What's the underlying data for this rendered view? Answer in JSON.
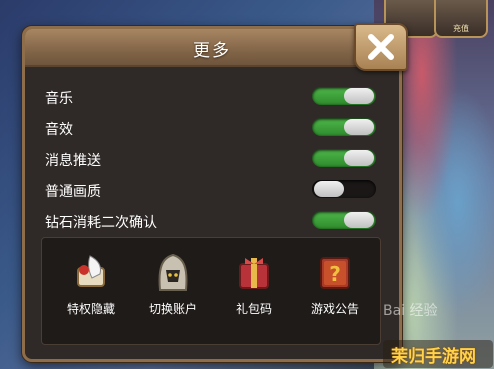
{
  "top_bar": {
    "left_label": "",
    "right_label": "充值"
  },
  "dialog": {
    "title": "更多",
    "settings": [
      {
        "label": "音乐",
        "enabled": true
      },
      {
        "label": "音效",
        "enabled": true
      },
      {
        "label": "消息推送",
        "enabled": true
      },
      {
        "label": "普通画质",
        "enabled": false
      },
      {
        "label": "钻石消耗二次确认",
        "enabled": true
      }
    ],
    "actions": [
      {
        "label": "特权隐藏",
        "icon": "scroll-feather-icon"
      },
      {
        "label": "切换账户",
        "icon": "hooded-figure-icon"
      },
      {
        "label": "礼包码",
        "icon": "gift-pack-icon"
      },
      {
        "label": "游戏公告",
        "icon": "question-book-icon"
      }
    ]
  },
  "watermark": "Bai 经验",
  "corner_badge": "茉归手游网",
  "colors": {
    "toggle_on": "#3ea63a",
    "panel_bg": "#2f2a27",
    "frame": "#8e6d4a"
  }
}
